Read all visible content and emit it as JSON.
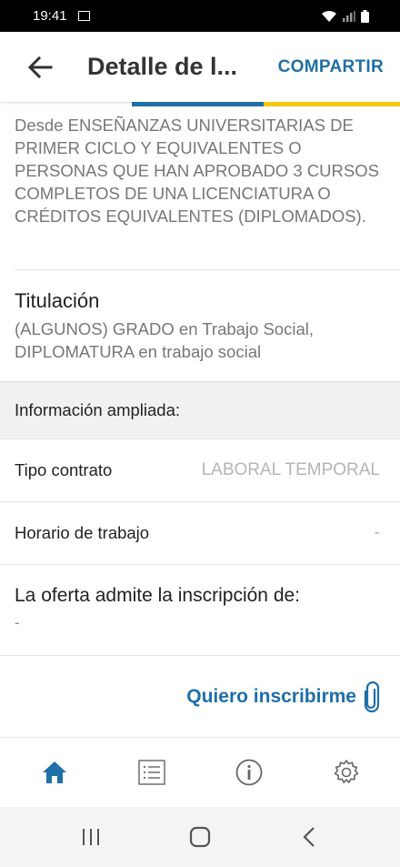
{
  "status": {
    "time": "19:41"
  },
  "header": {
    "title": "Detalle de l...",
    "share_label": "COMPARTIR"
  },
  "requirement": {
    "text": "Desde ENSEÑANZAS UNIVERSITARIAS DE PRIMER CICLO Y EQUIVALENTES O PERSONAS QUE HAN APROBADO 3 CURSOS COMPLETOS DE UNA LICENCIATURA O CRÉDITOS EQUIVALENTES (DIPLOMADOS)."
  },
  "titulacion": {
    "label": "Titulación",
    "value": "(ALGUNOS) GRADO en Trabajo Social, DIPLOMATURA en trabajo social"
  },
  "info": {
    "header": "Información ampliada:"
  },
  "rows": [
    {
      "label": "Tipo contrato",
      "value": "LABORAL TEMPORAL"
    },
    {
      "label": "Horario de trabajo",
      "value": "-"
    }
  ],
  "oferta": {
    "label": "La oferta admite la inscripción de:",
    "value": "-"
  },
  "action": {
    "label": "Quiero inscribirme"
  },
  "nav": {
    "items": [
      "home-icon",
      "list-icon",
      "info-icon",
      "settings-icon"
    ],
    "active": 0
  },
  "colors": {
    "accent": "#1f6fa8",
    "accent_yellow": "#f2c811",
    "muted": "#777777"
  }
}
